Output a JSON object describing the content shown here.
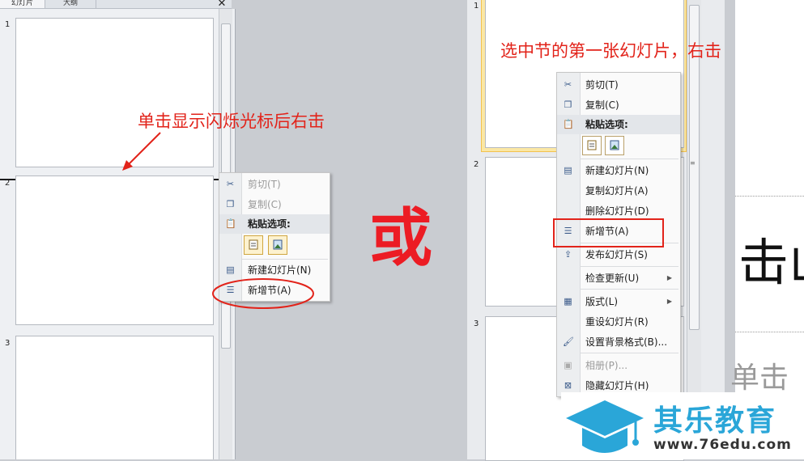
{
  "left_panel": {
    "tabs": [
      "幻灯片",
      "大纲"
    ],
    "close_symbol": "✕",
    "slide_numbers": [
      "1",
      "2",
      "3"
    ]
  },
  "left_menu": {
    "items": [
      {
        "label": "剪切(T)",
        "icon": "scissors-icon",
        "disabled": true
      },
      {
        "label": "复制(C)",
        "icon": "copy-icon",
        "disabled": true
      },
      {
        "label": "粘贴选项:",
        "icon": "paste-icon",
        "header": true
      },
      {
        "label": "新建幻灯片(N)",
        "icon": "new-slide-icon"
      },
      {
        "label": "新增节(A)",
        "icon": "add-section-icon"
      }
    ]
  },
  "right_panel": {
    "slide_numbers": [
      "1",
      "2",
      "3"
    ]
  },
  "right_menu": {
    "items": [
      {
        "label": "剪切(T)",
        "icon": "scissors-icon"
      },
      {
        "label": "复制(C)",
        "icon": "copy-icon"
      },
      {
        "label": "粘贴选项:",
        "icon": "paste-icon",
        "header": true
      },
      {
        "label": "新建幻灯片(N)",
        "icon": "new-slide-icon"
      },
      {
        "label": "复制幻灯片(A)"
      },
      {
        "label": "删除幻灯片(D)"
      },
      {
        "label": "新增节(A)",
        "icon": "add-section-icon"
      },
      {
        "label": "发布幻灯片(S)",
        "icon": "publish-icon"
      },
      {
        "label": "检查更新(U)",
        "submenu": true
      },
      {
        "label": "版式(L)",
        "icon": "layout-icon",
        "submenu": true
      },
      {
        "label": "重设幻灯片(R)"
      },
      {
        "label": "设置背景格式(B)...",
        "icon": "background-icon"
      },
      {
        "label": "相册(P)...",
        "icon": "album-icon",
        "disabled": true
      },
      {
        "label": "隐藏幻灯片(H)",
        "icon": "hide-slide-icon"
      }
    ]
  },
  "annotations": {
    "left_hint": "单击显示闪烁光标后右击",
    "or_text": "或",
    "right_hint": "选中节的第一张幻灯片，右击"
  },
  "slide_preview_text": {
    "large": "击山",
    "faded": "单击"
  },
  "watermark": {
    "name": "其乐教育",
    "url": "www.76edu.com"
  },
  "colors": {
    "annotation_red": "#e2231a",
    "logo_blue": "#2aa6d8",
    "selected_slide_border": "#f2c14e"
  }
}
